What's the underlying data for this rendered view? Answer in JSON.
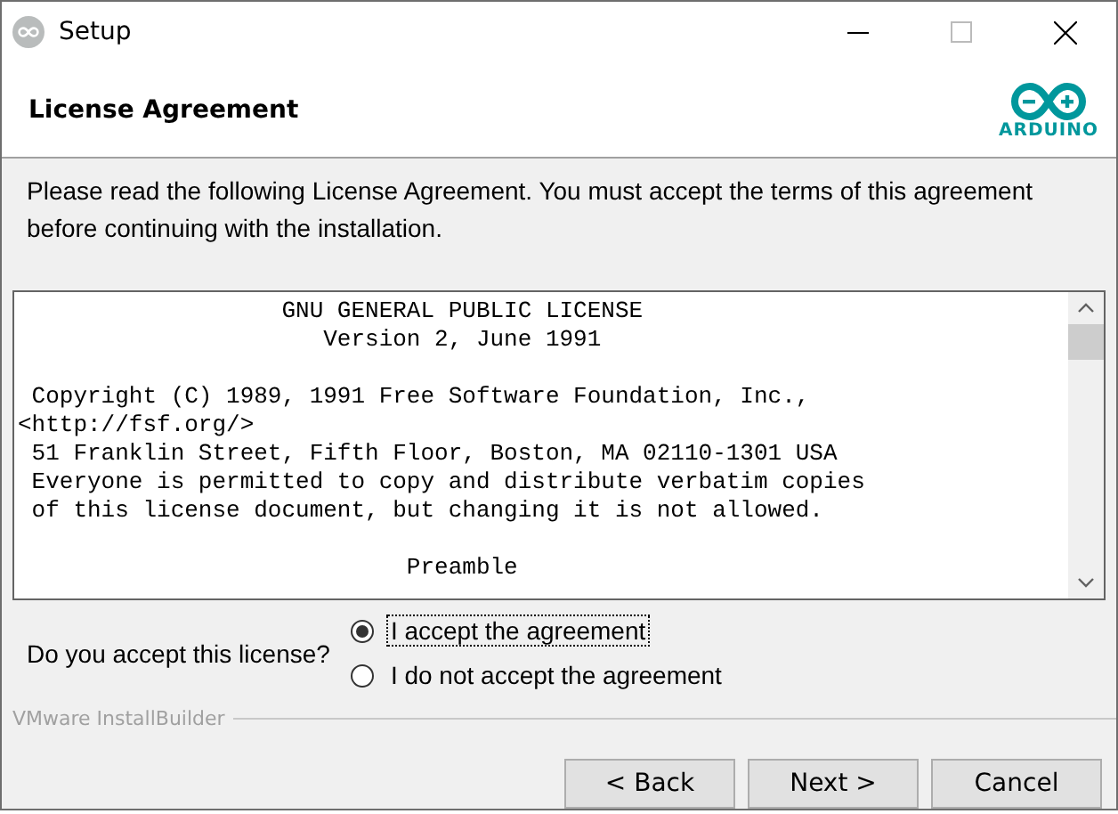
{
  "window": {
    "title": "Setup"
  },
  "header": {
    "title": "License Agreement",
    "logo_text": "ARDUINO"
  },
  "intro": "Please read the following License Agreement. You must accept the terms of this agreement before continuing with the installation.",
  "license_paragraphs": [
    [
      "                   GNU GENERAL PUBLIC LICENSE",
      "                      Version 2, June 1991"
    ],
    [
      " Copyright (C) 1989, 1991 Free Software Foundation, Inc.,",
      "<http://fsf.org/>",
      " 51 Franklin Street, Fifth Floor, Boston, MA 02110-1301 USA",
      " Everyone is permitted to copy and distribute verbatim copies",
      " of this license document, but changing it is not allowed."
    ],
    [
      "                            Preamble"
    ]
  ],
  "question": "Do you accept this license?",
  "options": [
    {
      "label": "I accept the agreement",
      "selected": true
    },
    {
      "label": "I do not accept the agreement",
      "selected": false
    }
  ],
  "footer_label": "VMware InstallBuilder",
  "buttons": [
    "< Back",
    "Next >",
    "Cancel"
  ]
}
